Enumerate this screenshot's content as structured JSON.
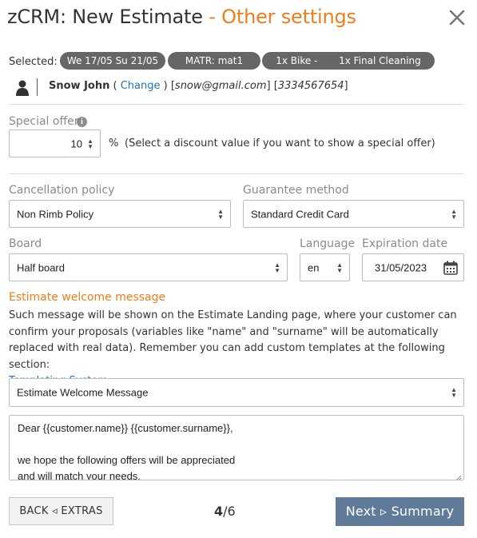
{
  "header": {
    "title_main": "zCRM: New Estimate",
    "title_accent": " - Other settings",
    "close_icon": "close-icon"
  },
  "selected": {
    "label": "Selected:",
    "pills": [
      "We 17/05 Su 21/05",
      "MATR: mat1",
      "1x Bike -       1x Final Cleaning"
    ]
  },
  "customer": {
    "icon": "user-icon",
    "name": "Snow John",
    "open_paren": " ( ",
    "change_label": "Change",
    "close_paren": " ) ",
    "email": "snow@gmail.com",
    "phone": "3334567654"
  },
  "special_offer": {
    "label": "Special offer",
    "value": "10",
    "unit": "%",
    "help": "(Select a discount value if you want to show a special offer)"
  },
  "cancellation": {
    "label": "Cancellation policy",
    "value": "Non Rimb Policy"
  },
  "guarantee": {
    "label": "Guarantee method",
    "value": "Standard Credit Card"
  },
  "board": {
    "label": "Board",
    "value": "Half board"
  },
  "language": {
    "label": "Language",
    "value": "en"
  },
  "expiration": {
    "label": "Expiration date",
    "value": "31/05/2023",
    "icon": "calendar-icon"
  },
  "welcome": {
    "title": "Estimate welcome message",
    "description": "Such message will be shown on the Estimate Landing page, where your customer can confirm your proposals (variables like \"name\" and \"surname\" will be automatically replaced with real data). Remember you can add custom templates at the following section:",
    "templating_link": "Templating System",
    "template_select": "Estimate Welcome Message",
    "message": "Dear {{customer.name}} {{customer.surname}},\n\nwe hope the following offers will be appreciated\nand will match your needs."
  },
  "footer": {
    "back_label": "BACK ◃ EXTRAS",
    "page_current": "4",
    "page_total": "/6",
    "next_label": "Next ▹ Summary"
  },
  "colors": {
    "accent": "#ef7d1a",
    "link": "#1f72b8",
    "primary_button": "#607b99",
    "pill": "#666666"
  }
}
